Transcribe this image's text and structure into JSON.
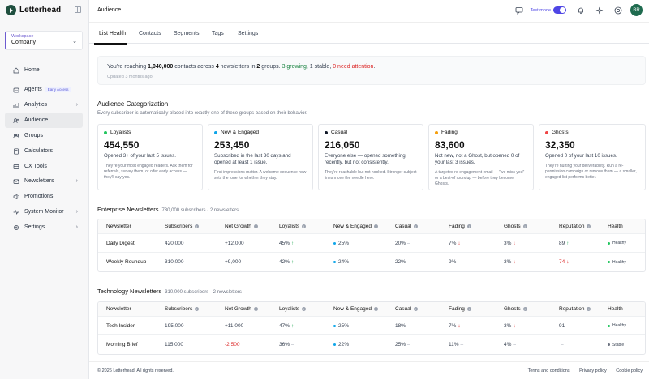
{
  "app": {
    "name": "Letterhead"
  },
  "workspace": {
    "label": "Workspace",
    "name": "Company"
  },
  "nav": [
    {
      "label": "Home",
      "icon": "home-icon"
    },
    {
      "label": "Agents",
      "icon": "agent-icon",
      "badge": "Early Access"
    },
    {
      "label": "Analytics",
      "icon": "analytics-icon",
      "chevron": true
    },
    {
      "label": "Audience",
      "icon": "audience-icon",
      "active": true
    },
    {
      "label": "Groups",
      "icon": "groups-icon"
    },
    {
      "label": "Calculators",
      "icon": "calculator-icon"
    },
    {
      "label": "CX Tools",
      "icon": "cx-tools-icon"
    },
    {
      "label": "Newsletters",
      "icon": "newsletters-icon",
      "chevron": true
    },
    {
      "label": "Promotions",
      "icon": "promotions-icon"
    },
    {
      "label": "System Monitor",
      "icon": "system-monitor-icon",
      "chevron": true
    },
    {
      "label": "Settings",
      "icon": "settings-icon",
      "chevron": true
    }
  ],
  "topbar": {
    "title": "Audience",
    "test_mode_label": "Test mode",
    "test_mode_on": true,
    "avatar_initials": "BR"
  },
  "tabs": [
    "List Health",
    "Contacts",
    "Segments",
    "Tags",
    "Settings"
  ],
  "summary": {
    "prefix": "You're reaching ",
    "contacts": "1,040,000",
    "mid1": " contacts across ",
    "newsletters": "4",
    "mid2": " newsletters in ",
    "groups": "2",
    "mid3": " groups. ",
    "growing": "3 growing",
    "mid4": ", 1 stable, ",
    "attention": "0 need attention",
    "suffix": ".",
    "updated": "Updated 3 months ago"
  },
  "categorization": {
    "title": "Audience Categorization",
    "subtitle": "Every subscriber is automatically placed into exactly one of these groups based on their behavior.",
    "cards": [
      {
        "name": "Loyalists",
        "color": "#22c55e",
        "value": "454,550",
        "desc": "Opened 3+ of your last 5 issues.",
        "note": "They're your most engaged readers. Ask them for referrals, survey them, or offer early access — they'll say yes."
      },
      {
        "name": "New & Engaged",
        "color": "#0ea5e9",
        "value": "253,450",
        "desc": "Subscribed in the last 30 days and opened at least 1 issue.",
        "note": "First impressions matter. A welcome sequence now sets the tone for whether they stay."
      },
      {
        "name": "Casual",
        "color": "#111827",
        "value": "216,050",
        "desc": "Everyone else — opened something recently, but not consistently.",
        "note": "They're reachable but not hooked. Stronger subject lines move the needle here."
      },
      {
        "name": "Fading",
        "color": "#f59e0b",
        "value": "83,600",
        "desc": "Not new, not a Ghost, but opened 0 of your last 3 issues.",
        "note": "A targeted re-engagement email — \"we miss you\" or a best-of roundup — before they become Ghosts."
      },
      {
        "name": "Ghosts",
        "color": "#ef4444",
        "value": "32,350",
        "desc": "Opened 0 of your last 10 issues.",
        "note": "They're hurting your deliverability. Run a re-permission campaign or remove them — a smaller, engaged list performs better."
      }
    ]
  },
  "columns": [
    "Newsletter",
    "Subscribers",
    "Net Growth",
    "Loyalists",
    "New & Engaged",
    "Casual",
    "Fading",
    "Ghosts",
    "Reputation",
    "Health"
  ],
  "groups": [
    {
      "title": "Enterprise Newsletters",
      "meta": "730,000 subscribers · 2 newsletters",
      "rows": [
        {
          "name": "Daily Digest",
          "subscribers": "420,000",
          "growth": "+12,000",
          "growth_tone": "pos",
          "loyalists": "45%",
          "loyalists_trend": "up",
          "new": "25%",
          "casual": "20%",
          "casual_trend": "flat",
          "fading": "7%",
          "fading_trend": "down",
          "ghosts": "3%",
          "ghosts_trend": "down",
          "reputation": "89",
          "rep_trend": "up",
          "rep_tone": "pos",
          "health": "Healthy",
          "health_color": "#22c55e"
        },
        {
          "name": "Weekly Roundup",
          "subscribers": "310,000",
          "growth": "+9,000",
          "growth_tone": "pos",
          "loyalists": "42%",
          "loyalists_trend": "up",
          "new": "24%",
          "casual": "22%",
          "casual_trend": "flat",
          "fading": "9%",
          "fading_trend": "flat",
          "ghosts": "3%",
          "ghosts_trend": "down",
          "reputation": "74",
          "rep_trend": "down",
          "rep_tone": "neg",
          "health": "Healthy",
          "health_color": "#22c55e"
        }
      ]
    },
    {
      "title": "Technology Newsletters",
      "meta": "310,000 subscribers · 2 newsletters",
      "rows": [
        {
          "name": "Tech Insider",
          "subscribers": "195,000",
          "growth": "+11,000",
          "growth_tone": "pos",
          "loyalists": "47%",
          "loyalists_trend": "up",
          "new": "25%",
          "casual": "18%",
          "casual_trend": "flat",
          "fading": "7%",
          "fading_trend": "down",
          "ghosts": "3%",
          "ghosts_trend": "down",
          "reputation": "91",
          "rep_trend": "flat",
          "rep_tone": "neu",
          "health": "Healthy",
          "health_color": "#22c55e"
        },
        {
          "name": "Morning Brief",
          "subscribers": "115,000",
          "growth": "-2,500",
          "growth_tone": "neg",
          "loyalists": "36%",
          "loyalists_trend": "flat",
          "new": "22%",
          "casual": "25%",
          "casual_trend": "flat",
          "fading": "11%",
          "fading_trend": "flat",
          "ghosts": "4%",
          "ghosts_trend": "flat",
          "reputation": "",
          "rep_trend": "flat",
          "rep_tone": "neu",
          "health": "Stable",
          "health_color": "#6b7280"
        }
      ]
    }
  ],
  "footer": {
    "copyright": "© 2026 Letterhead. All rights reserved.",
    "links": [
      "Terms and conditions",
      "Privacy policy",
      "Cookie policy"
    ]
  }
}
